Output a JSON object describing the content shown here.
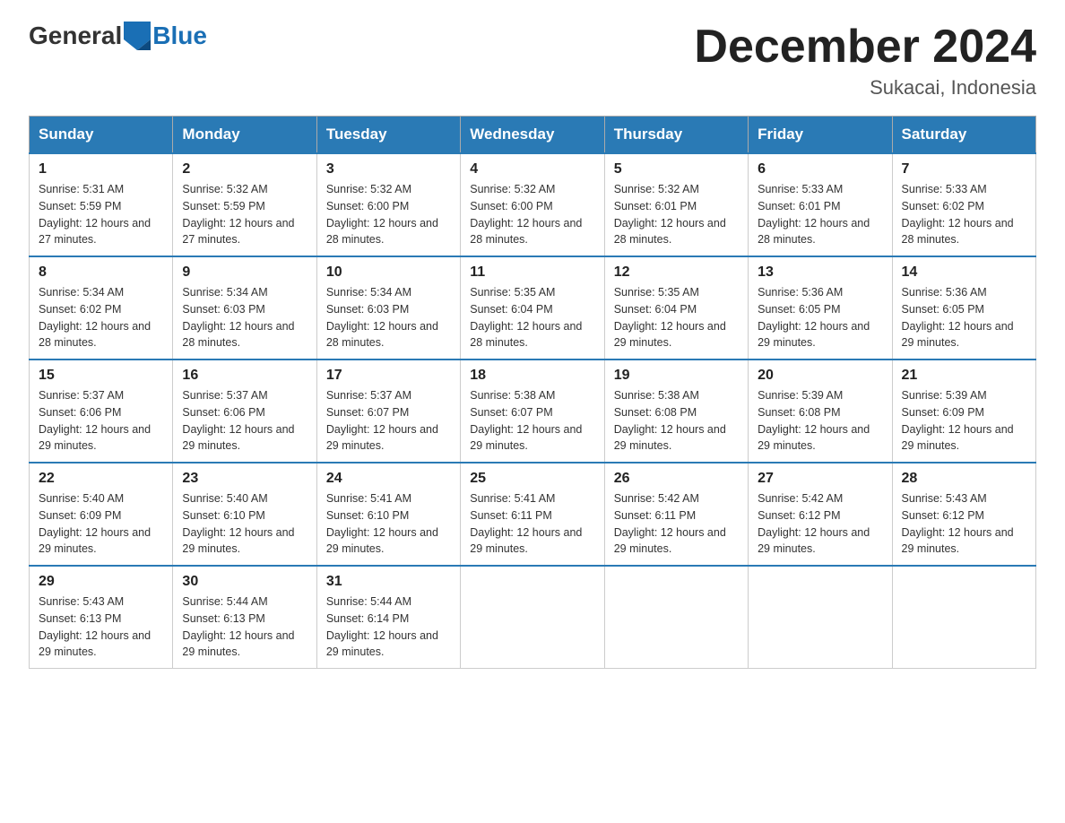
{
  "header": {
    "logo_general": "General",
    "logo_blue": "Blue",
    "title": "December 2024",
    "location": "Sukacai, Indonesia"
  },
  "weekdays": [
    "Sunday",
    "Monday",
    "Tuesday",
    "Wednesday",
    "Thursday",
    "Friday",
    "Saturday"
  ],
  "weeks": [
    [
      {
        "day": "1",
        "sunrise": "5:31 AM",
        "sunset": "5:59 PM",
        "daylight": "12 hours and 27 minutes."
      },
      {
        "day": "2",
        "sunrise": "5:32 AM",
        "sunset": "5:59 PM",
        "daylight": "12 hours and 27 minutes."
      },
      {
        "day": "3",
        "sunrise": "5:32 AM",
        "sunset": "6:00 PM",
        "daylight": "12 hours and 28 minutes."
      },
      {
        "day": "4",
        "sunrise": "5:32 AM",
        "sunset": "6:00 PM",
        "daylight": "12 hours and 28 minutes."
      },
      {
        "day": "5",
        "sunrise": "5:32 AM",
        "sunset": "6:01 PM",
        "daylight": "12 hours and 28 minutes."
      },
      {
        "day": "6",
        "sunrise": "5:33 AM",
        "sunset": "6:01 PM",
        "daylight": "12 hours and 28 minutes."
      },
      {
        "day": "7",
        "sunrise": "5:33 AM",
        "sunset": "6:02 PM",
        "daylight": "12 hours and 28 minutes."
      }
    ],
    [
      {
        "day": "8",
        "sunrise": "5:34 AM",
        "sunset": "6:02 PM",
        "daylight": "12 hours and 28 minutes."
      },
      {
        "day": "9",
        "sunrise": "5:34 AM",
        "sunset": "6:03 PM",
        "daylight": "12 hours and 28 minutes."
      },
      {
        "day": "10",
        "sunrise": "5:34 AM",
        "sunset": "6:03 PM",
        "daylight": "12 hours and 28 minutes."
      },
      {
        "day": "11",
        "sunrise": "5:35 AM",
        "sunset": "6:04 PM",
        "daylight": "12 hours and 28 minutes."
      },
      {
        "day": "12",
        "sunrise": "5:35 AM",
        "sunset": "6:04 PM",
        "daylight": "12 hours and 29 minutes."
      },
      {
        "day": "13",
        "sunrise": "5:36 AM",
        "sunset": "6:05 PM",
        "daylight": "12 hours and 29 minutes."
      },
      {
        "day": "14",
        "sunrise": "5:36 AM",
        "sunset": "6:05 PM",
        "daylight": "12 hours and 29 minutes."
      }
    ],
    [
      {
        "day": "15",
        "sunrise": "5:37 AM",
        "sunset": "6:06 PM",
        "daylight": "12 hours and 29 minutes."
      },
      {
        "day": "16",
        "sunrise": "5:37 AM",
        "sunset": "6:06 PM",
        "daylight": "12 hours and 29 minutes."
      },
      {
        "day": "17",
        "sunrise": "5:37 AM",
        "sunset": "6:07 PM",
        "daylight": "12 hours and 29 minutes."
      },
      {
        "day": "18",
        "sunrise": "5:38 AM",
        "sunset": "6:07 PM",
        "daylight": "12 hours and 29 minutes."
      },
      {
        "day": "19",
        "sunrise": "5:38 AM",
        "sunset": "6:08 PM",
        "daylight": "12 hours and 29 minutes."
      },
      {
        "day": "20",
        "sunrise": "5:39 AM",
        "sunset": "6:08 PM",
        "daylight": "12 hours and 29 minutes."
      },
      {
        "day": "21",
        "sunrise": "5:39 AM",
        "sunset": "6:09 PM",
        "daylight": "12 hours and 29 minutes."
      }
    ],
    [
      {
        "day": "22",
        "sunrise": "5:40 AM",
        "sunset": "6:09 PM",
        "daylight": "12 hours and 29 minutes."
      },
      {
        "day": "23",
        "sunrise": "5:40 AM",
        "sunset": "6:10 PM",
        "daylight": "12 hours and 29 minutes."
      },
      {
        "day": "24",
        "sunrise": "5:41 AM",
        "sunset": "6:10 PM",
        "daylight": "12 hours and 29 minutes."
      },
      {
        "day": "25",
        "sunrise": "5:41 AM",
        "sunset": "6:11 PM",
        "daylight": "12 hours and 29 minutes."
      },
      {
        "day": "26",
        "sunrise": "5:42 AM",
        "sunset": "6:11 PM",
        "daylight": "12 hours and 29 minutes."
      },
      {
        "day": "27",
        "sunrise": "5:42 AM",
        "sunset": "6:12 PM",
        "daylight": "12 hours and 29 minutes."
      },
      {
        "day": "28",
        "sunrise": "5:43 AM",
        "sunset": "6:12 PM",
        "daylight": "12 hours and 29 minutes."
      }
    ],
    [
      {
        "day": "29",
        "sunrise": "5:43 AM",
        "sunset": "6:13 PM",
        "daylight": "12 hours and 29 minutes."
      },
      {
        "day": "30",
        "sunrise": "5:44 AM",
        "sunset": "6:13 PM",
        "daylight": "12 hours and 29 minutes."
      },
      {
        "day": "31",
        "sunrise": "5:44 AM",
        "sunset": "6:14 PM",
        "daylight": "12 hours and 29 minutes."
      },
      null,
      null,
      null,
      null
    ]
  ]
}
